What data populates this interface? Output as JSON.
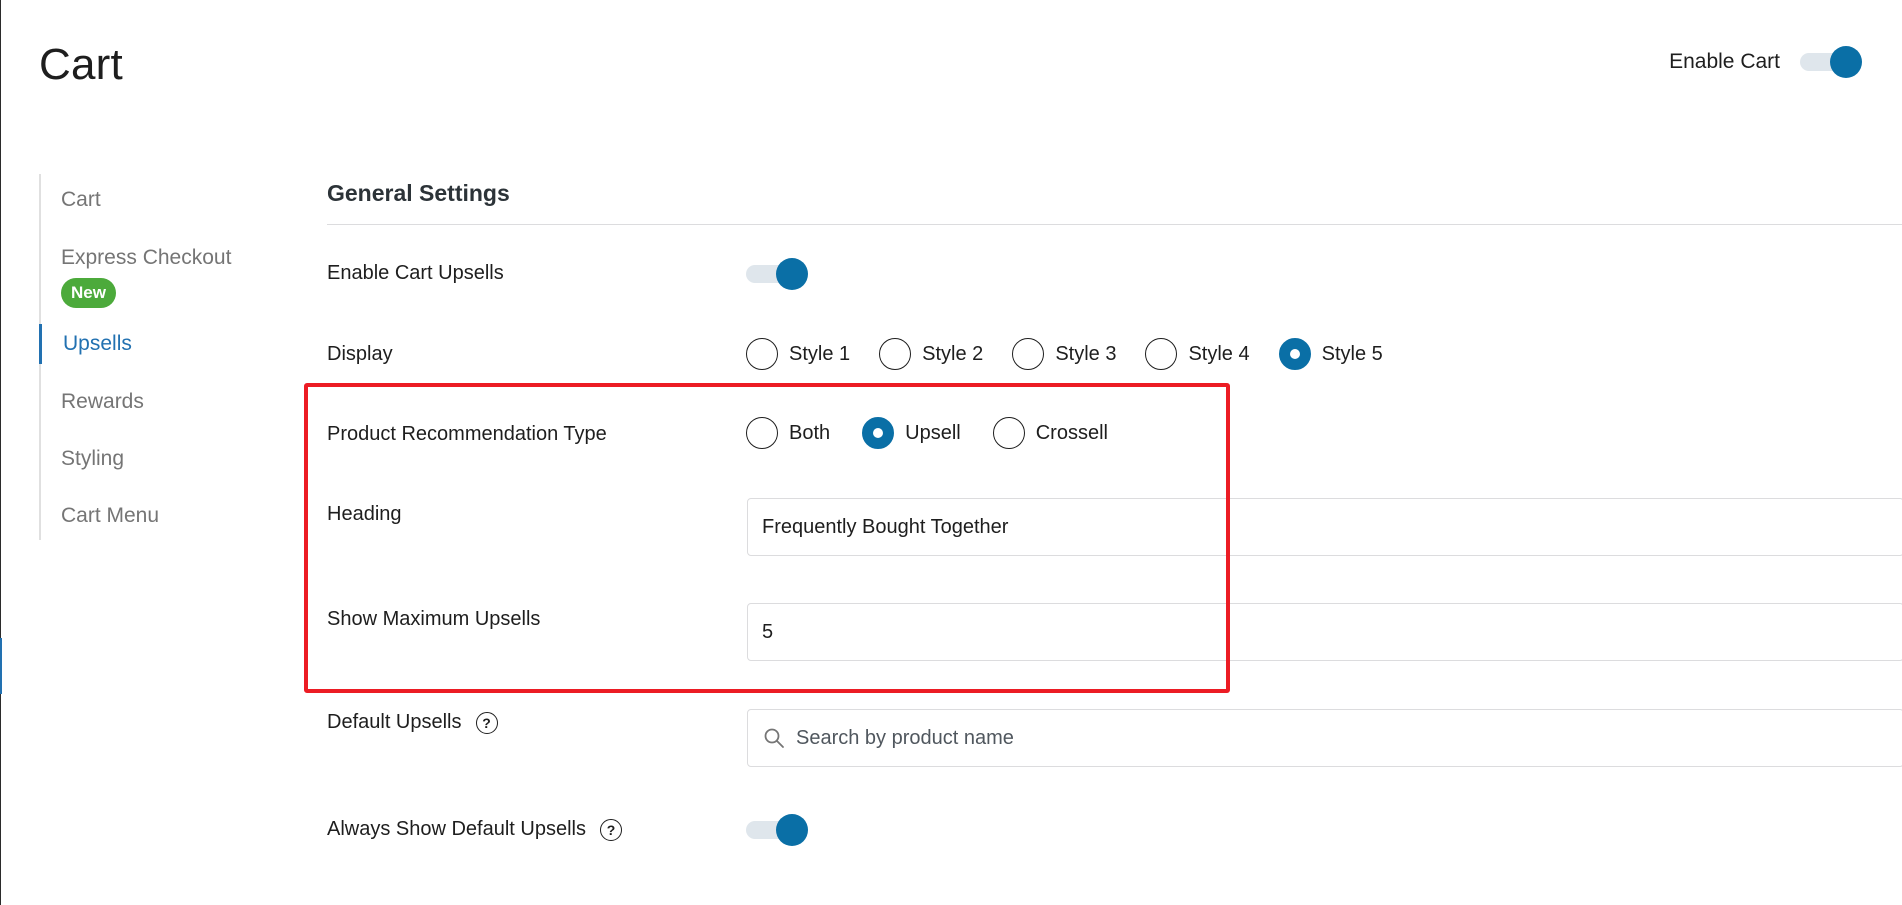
{
  "page": {
    "title": "Cart"
  },
  "header": {
    "enable_cart_label": "Enable Cart"
  },
  "sidebar": {
    "items": [
      {
        "label": "Cart"
      },
      {
        "label": "Express Checkout",
        "badge": "New"
      },
      {
        "label": "Upsells",
        "active": true
      },
      {
        "label": "Rewards"
      },
      {
        "label": "Styling"
      },
      {
        "label": "Cart Menu"
      }
    ]
  },
  "main": {
    "section_title": "General Settings",
    "enable_upsells": {
      "label": "Enable Cart Upsells",
      "enabled": true
    },
    "display": {
      "label": "Display",
      "options": [
        "Style 1",
        "Style 2",
        "Style 3",
        "Style 4",
        "Style 5"
      ],
      "selected": "Style 5"
    },
    "recommendation_type": {
      "label": "Product Recommendation Type",
      "options": [
        "Both",
        "Upsell",
        "Crossell"
      ],
      "selected": "Upsell"
    },
    "heading": {
      "label": "Heading",
      "value": "Frequently Bought Together"
    },
    "max_upsells": {
      "label": "Show Maximum Upsells",
      "value": "5"
    },
    "default_upsells": {
      "label": "Default Upsells",
      "placeholder": "Search by product name"
    },
    "always_show_default": {
      "label": "Always Show Default Upsells",
      "enabled": true
    }
  },
  "colors": {
    "accent": "#0a6fa6",
    "link_active": "#2271b1",
    "badge_green": "#4caa3b",
    "highlight_red": "#ec1c24"
  },
  "icons": {
    "help": "question-mark-circle-icon",
    "search": "magnifier-icon"
  }
}
